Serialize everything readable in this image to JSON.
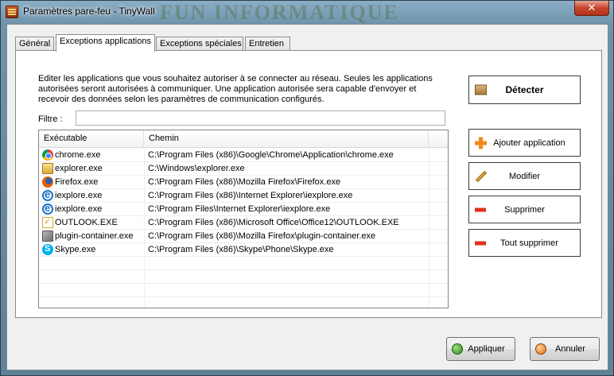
{
  "window": {
    "title": "Paramètres pare-feu - TinyWall",
    "watermark": "FUN INFORMATIQUE",
    "close_glyph": "✕"
  },
  "tabs": [
    {
      "label": "Général",
      "active": false
    },
    {
      "label": "Exceptions applications",
      "active": true
    },
    {
      "label": "Exceptions spéciales",
      "active": false
    },
    {
      "label": "Entretien",
      "active": false
    }
  ],
  "panel": {
    "description": "Editer les applications que vous souhaitez autoriser à se connecter au réseau. Seules les applications autorisées seront autorisées à communiquer. Une application autorisée sera capable d'envoyer et recevoir des données selon les paramètres de communication configurés.",
    "filter_label": "Filtre :",
    "filter_value": "",
    "columns": {
      "exe": "Exécutable",
      "path": "Chemin"
    },
    "rows": [
      {
        "exe": "chrome.exe",
        "path": "C:\\Program Files (x86)\\Google\\Chrome\\Application\\chrome.exe",
        "icon": "chrome-icon"
      },
      {
        "exe": "explorer.exe",
        "path": "C:\\Windows\\explorer.exe",
        "icon": "explorer-icon"
      },
      {
        "exe": "Firefox.exe",
        "path": "C:\\Program Files (x86)\\Mozilla Firefox\\Firefox.exe",
        "icon": "firefox-icon"
      },
      {
        "exe": "iexplore.exe",
        "path": "C:\\Program Files (x86)\\Internet Explorer\\iexplore.exe",
        "icon": "ie-icon"
      },
      {
        "exe": "iexplore.exe",
        "path": "C:\\Program Files\\Internet Explorer\\iexplore.exe",
        "icon": "ie-icon"
      },
      {
        "exe": "OUTLOOK.EXE",
        "path": "C:\\Program Files (x86)\\Microsoft Office\\Office12\\OUTLOOK.EXE",
        "icon": "outlook-icon"
      },
      {
        "exe": "plugin-container.exe",
        "path": "C:\\Program Files (x86)\\Mozilla Firefox\\plugin-container.exe",
        "icon": "plugin-icon"
      },
      {
        "exe": "Skype.exe",
        "path": "C:\\Program Files (x86)\\Skype\\Phone\\Skype.exe",
        "icon": "skype-icon"
      }
    ],
    "empty_rows": 4
  },
  "side_buttons": {
    "detect": "Détecter",
    "add": "Ajouter application",
    "modify": "Modifier",
    "delete": "Supprimer",
    "delete_all": "Tout supprimer"
  },
  "footer": {
    "apply": "Appliquer",
    "cancel": "Annuler"
  }
}
